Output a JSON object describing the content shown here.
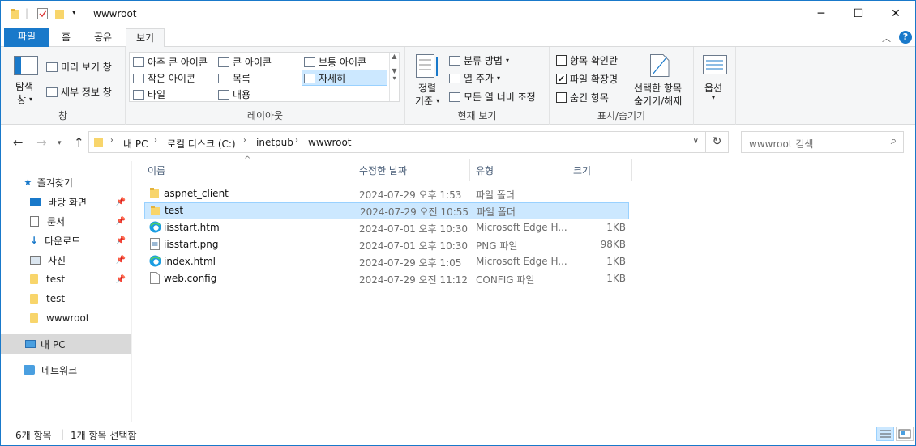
{
  "window": {
    "title": "wwwroot",
    "controls": {
      "minimize": "─",
      "maximize": "☐",
      "close": "✕"
    }
  },
  "ribbon_tabs": [
    "파일",
    "홈",
    "공유",
    "보기"
  ],
  "ribbon": {
    "pane_group": {
      "nav_pane_line1": "탐색",
      "nav_pane_line2": "창",
      "preview": "미리 보기 창",
      "details": "세부 정보 창",
      "label": "창"
    },
    "layout_group": {
      "items": [
        "아주 큰 아이콘",
        "큰 아이콘",
        "보통 아이콘",
        "작은 아이콘",
        "목록",
        "자세히",
        "타일",
        "내용"
      ],
      "selected": "자세히",
      "label": "레이아웃"
    },
    "current_view_group": {
      "sort_line1": "정렬",
      "sort_line2": "기준",
      "group_by": "분류 방법",
      "add_columns": "열 추가",
      "fit_columns": "모든 열 너비 조정",
      "label": "현재 보기"
    },
    "show_hide_group": {
      "item_checkboxes": "항목 확인란",
      "item_checkboxes_checked": false,
      "file_extensions": "파일 확장명",
      "file_extensions_checked": true,
      "hidden_items": "숨긴 항목",
      "hidden_items_checked": false,
      "hide_selected_line1": "선택한 항목",
      "hide_selected_line2": "숨기기/해제",
      "label": "표시/숨기기"
    },
    "options": "옵션"
  },
  "address_bar": {
    "breadcrumb": [
      "내 PC",
      "로컬 디스크 (C:)",
      "inetpub",
      "wwwroot"
    ],
    "search_placeholder": "wwwroot 검색"
  },
  "nav_pane": {
    "quick_access": "즐겨찾기",
    "items": [
      "바탕 화면",
      "문서",
      "다운로드",
      "사진",
      "test",
      "test",
      "wwwroot"
    ],
    "this_pc": "내 PC",
    "network": "네트워크"
  },
  "columns": {
    "name": "이름",
    "modified": "수정한 날짜",
    "type": "유형",
    "size": "크기"
  },
  "files": [
    {
      "name": "aspnet_client",
      "modified": "2024-07-29 오후 1:53",
      "type": "파일 폴더",
      "size": "",
      "icon": "folder-icon"
    },
    {
      "name": "test",
      "modified": "2024-07-29 오전 10:55",
      "type": "파일 폴더",
      "size": "",
      "icon": "folder-icon",
      "selected": true
    },
    {
      "name": "iisstart.htm",
      "modified": "2024-07-01 오후 10:30",
      "type": "Microsoft Edge H...",
      "size": "1KB",
      "icon": "edge-icon"
    },
    {
      "name": "iisstart.png",
      "modified": "2024-07-01 오후 10:30",
      "type": "PNG 파일",
      "size": "98KB",
      "icon": "image-file-icon"
    },
    {
      "name": "index.html",
      "modified": "2024-07-29 오후 1:05",
      "type": "Microsoft Edge H...",
      "size": "1KB",
      "icon": "edge-icon"
    },
    {
      "name": "web.config",
      "modified": "2024-07-29 오전 11:12",
      "type": "CONFIG 파일",
      "size": "1KB",
      "icon": "file-icon"
    }
  ],
  "status_bar": {
    "item_count": "6개 항목",
    "selected_count": "1개 항목 선택함"
  },
  "colors": {
    "accent": "#1979ca",
    "selection": "#cce8ff",
    "selection_border": "#99d1ff",
    "folder": "#f8d56b"
  }
}
